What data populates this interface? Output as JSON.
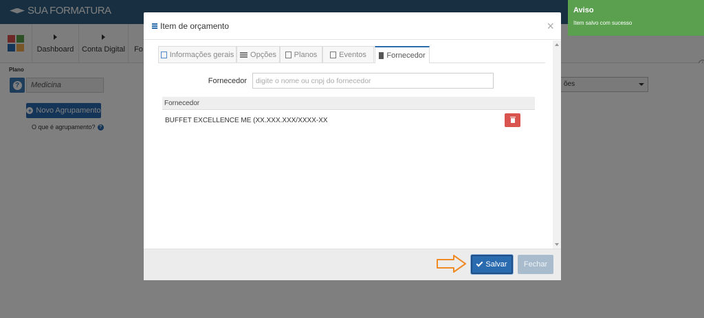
{
  "app": {
    "brand": "SUA FORMATURA"
  },
  "nav": {
    "items": [
      {
        "label": "Dashboard"
      },
      {
        "label": "Conta Digital"
      },
      {
        "label": "Fo"
      }
    ]
  },
  "colors": {
    "brand_bar": "#2f5e80",
    "primary": "#2a6bb0",
    "danger": "#d9534f",
    "success_toast": "#5aa04f",
    "arrow": "#f08a24"
  },
  "page": {
    "plano_label": "Plano",
    "plano_value": "Medicina",
    "new_group_button": "Novo Agrupamento",
    "what_is_grouping_link": "O que é agrupamento?",
    "right_select_value": "ões"
  },
  "modal": {
    "title": "Item de orçamento",
    "close": "×",
    "tabs": [
      {
        "label": "Informações gerais",
        "icon": "document-icon",
        "active": false
      },
      {
        "label": "Opções",
        "icon": "list-icon",
        "active": false
      },
      {
        "label": "Planos",
        "icon": "table-icon",
        "active": false
      },
      {
        "label": "Eventos",
        "icon": "calendar-icon",
        "active": false
      },
      {
        "label": "Fornecedor",
        "icon": "building-icon",
        "active": true
      }
    ],
    "fornecedor_label": "Fornecedor",
    "fornecedor_placeholder": "digite o nome ou cnpj do fornecedor",
    "table": {
      "header": "Fornecedor",
      "rows": [
        {
          "name": "BUFFET EXCELLENCE ME (XX.XXX.XXX/XXXX-XX"
        }
      ]
    },
    "save_button": "Salvar",
    "close_button": "Fechar"
  },
  "toast": {
    "title": "Aviso",
    "message": "Item salvo com sucesso"
  }
}
